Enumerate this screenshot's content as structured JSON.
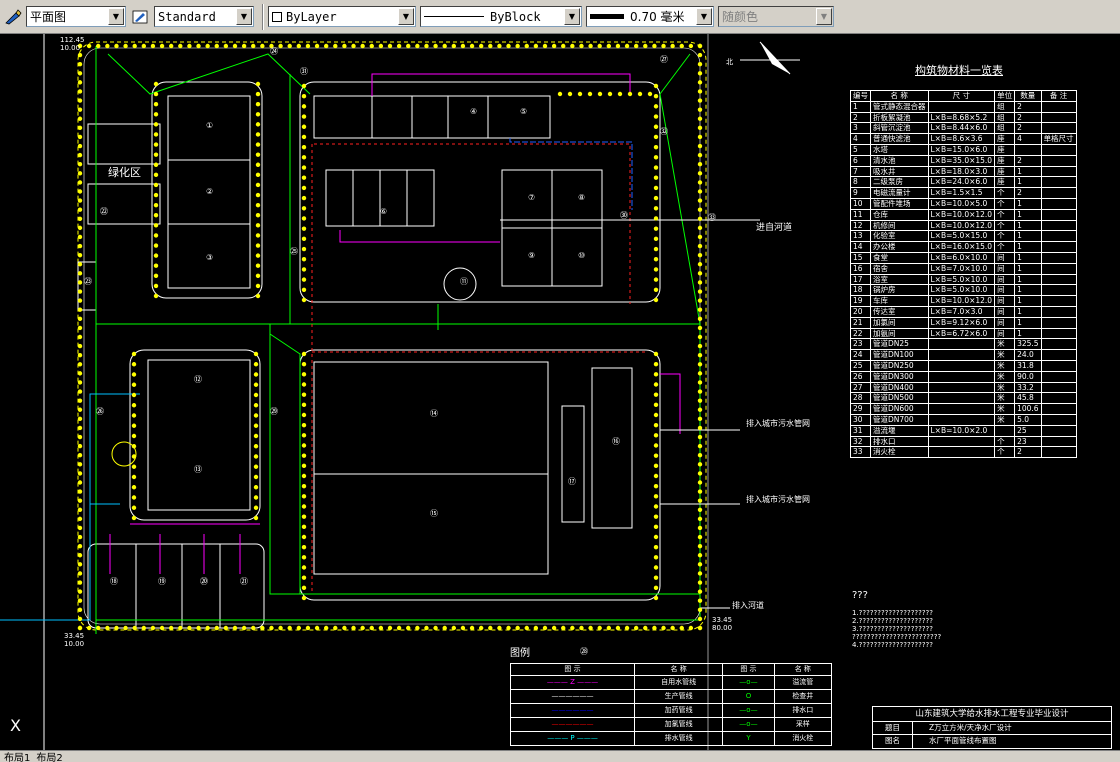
{
  "toolbar": {
    "workspace_value": "平面图",
    "style_value": "Standard",
    "layer_value": "ByLayer",
    "linetype_value": "ByBlock",
    "lineweight_value": "0.70 毫米",
    "plotstyle_value": "随颜色"
  },
  "colors": {
    "background": "#000000",
    "green": "#00ff00",
    "magenta": "#ff00ff",
    "blue": "#0000ff",
    "red": "#ff0000",
    "yellow": "#ffff00",
    "cyan": "#00ffff",
    "white": "#ffffff"
  },
  "drawing": {
    "north_label": "北",
    "coords": {
      "top_left": "112.45",
      "top_left_sub": "10.00",
      "bottom_left": "33.45",
      "bottom_left_sub": "10.00",
      "bottom_right": "33.45",
      "bottom_right_sub": "80.00"
    },
    "building_labels": [
      "①",
      "②",
      "③",
      "④",
      "⑤",
      "⑥",
      "⑦",
      "⑧",
      "⑨",
      "⑩",
      "⑪",
      "⑫",
      "⑬",
      "⑭",
      "⑮",
      "⑯",
      "⑰",
      "⑱",
      "⑲",
      "⑳",
      "㉑",
      "㉒",
      "㉓",
      "㉔",
      "㉕",
      "㉖",
      "㉗",
      "㉘",
      "㉙",
      "㉚",
      "㉛",
      "㉜",
      "㉝"
    ],
    "pipe_letters": {
      "z": "Z",
      "y": "Y",
      "c": "C",
      "p": "P"
    },
    "annotations": {
      "water_in": "进自河道",
      "drain_1": "排入城市污水管网",
      "drain_2": "排入城市污水管网",
      "drain_3": "排入河道",
      "garden": "绿化区"
    }
  },
  "table": {
    "title": "构筑物材料一览表",
    "headers": [
      "编号",
      "名    称",
      "尺  寸",
      "单位",
      "数量",
      "备 注"
    ],
    "rows": [
      [
        "1",
        "管式静态混合器",
        "",
        "组",
        "2",
        ""
      ],
      [
        "2",
        "折板絮凝池",
        "L×B=8.68×5.2",
        "组",
        "2",
        ""
      ],
      [
        "3",
        "斜管沉淀池",
        "L×B=8.44×6.0",
        "组",
        "2",
        ""
      ],
      [
        "4",
        "普通快滤池",
        "L×B=8.6×3.6",
        "座",
        "4",
        "单格尺寸"
      ],
      [
        "5",
        "水塔",
        "L×B=15.0×6.0",
        "座",
        "",
        ""
      ],
      [
        "6",
        "清水池",
        "L×B=35.0×15.0",
        "座",
        "2",
        ""
      ],
      [
        "7",
        "吸水井",
        "L×B=18.0×3.0",
        "座",
        "1",
        ""
      ],
      [
        "8",
        "二级泵房",
        "L×B=24.0×6.0",
        "座",
        "1",
        ""
      ],
      [
        "9",
        "电磁流量计",
        "L×B=1.5×1.5",
        "个",
        "2",
        ""
      ],
      [
        "10",
        "管配件堆场",
        "L×B=10.0×5.0",
        "个",
        "1",
        ""
      ],
      [
        "11",
        "仓库",
        "L×B=10.0×12.0",
        "个",
        "1",
        ""
      ],
      [
        "12",
        "机修间",
        "L×B=10.0×12.0",
        "个",
        "1",
        ""
      ],
      [
        "13",
        "化验室",
        "L×B=5.0×15.0",
        "个",
        "1",
        ""
      ],
      [
        "14",
        "办公楼",
        "L×B=16.0×15.0",
        "个",
        "1",
        ""
      ],
      [
        "15",
        "食堂",
        "L×B=6.0×10.0",
        "间",
        "1",
        ""
      ],
      [
        "16",
        "宿舍",
        "L×B=7.0×10.0",
        "间",
        "1",
        ""
      ],
      [
        "17",
        "浴室",
        "L×B=5.0×10.0",
        "间",
        "1",
        ""
      ],
      [
        "18",
        "锅炉房",
        "L×B=5.0×10.0",
        "间",
        "1",
        ""
      ],
      [
        "19",
        "车库",
        "L×B=10.0×12.0",
        "间",
        "1",
        ""
      ],
      [
        "20",
        "传达室",
        "L×B=7.0×3.0",
        "间",
        "1",
        ""
      ],
      [
        "21",
        "加氯间",
        "L×B=9.12×6.0",
        "间",
        "1",
        ""
      ],
      [
        "22",
        "加氨间",
        "L×B=6.72×6.0",
        "间",
        "1",
        ""
      ],
      [
        "23",
        "管道DN25",
        "",
        "米",
        "325.5",
        ""
      ],
      [
        "24",
        "管道DN100",
        "",
        "米",
        "24.0",
        ""
      ],
      [
        "25",
        "管道DN250",
        "",
        "米",
        "31.8",
        ""
      ],
      [
        "26",
        "管道DN300",
        "",
        "米",
        "90.0",
        ""
      ],
      [
        "27",
        "管道DN400",
        "",
        "米",
        "33.2",
        ""
      ],
      [
        "28",
        "管道DN500",
        "",
        "米",
        "45.8",
        ""
      ],
      [
        "29",
        "管道DN600",
        "",
        "米",
        "100.6",
        ""
      ],
      [
        "30",
        "管道DN700",
        "",
        "米",
        "5.0",
        ""
      ],
      [
        "31",
        "溢流堰",
        "L×B=10.0×2.0",
        "",
        "25",
        ""
      ],
      [
        "32",
        "排水口",
        "",
        "个",
        "23",
        ""
      ],
      [
        "33",
        "消火栓",
        "",
        "个",
        "2",
        ""
      ]
    ]
  },
  "notes": {
    "heading": "???",
    "lines": [
      "1.????????????????????",
      "2.????????????????????",
      "3.????????????????????",
      "????????????????????????",
      "4.????????????????????"
    ]
  },
  "legend": {
    "title": "图例",
    "headers": [
      "图  示",
      "名    称",
      "图  示",
      "名    称"
    ],
    "rows": [
      [
        "Z",
        "自用水管线",
        "",
        "溢流管"
      ],
      [
        "",
        "生产管线",
        "O",
        "检查井"
      ],
      [
        "",
        "加药管线",
        "",
        "排水口"
      ],
      [
        "",
        "加氯管线",
        "",
        "采样"
      ],
      [
        "P",
        "排水管线",
        "Y",
        "消火栓"
      ]
    ]
  },
  "titleblock": {
    "school": "山东建筑大学给水排水工程专业毕业设计",
    "row1_label": "题目",
    "row1_value": "Z万立方米/天净水厂设计",
    "row2_label": "图名",
    "row2_value": "水厂平面管线布置图"
  },
  "tabs": [
    "布局1",
    "布局2"
  ]
}
